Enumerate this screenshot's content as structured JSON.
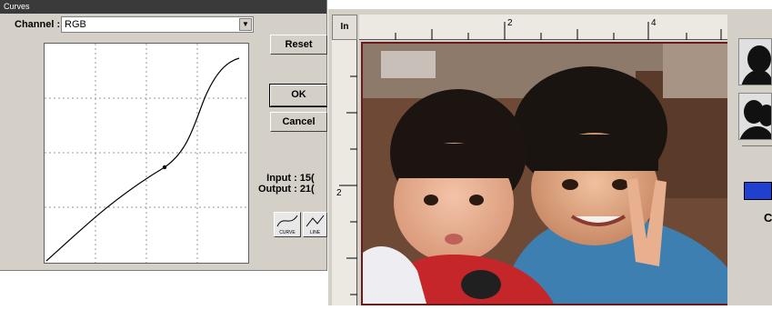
{
  "curves_dialog": {
    "title": "Curves",
    "channel_label": "Channel :",
    "channel_value": "RGB",
    "reset_label": "Reset",
    "ok_label": "OK",
    "cancel_label": "Cancel",
    "input_label": "Input : 15(",
    "output_label": "Output : 21(",
    "mode_buttons": [
      {
        "label": "CURVE",
        "icon": "curve-tool-icon"
      },
      {
        "label": "LINE",
        "icon": "line-tool-icon"
      }
    ]
  },
  "preview": {
    "unit_label": "In",
    "ruler_top_numbers": [
      "2",
      "4"
    ],
    "ruler_left_numbers": [
      "2"
    ]
  },
  "side_panel": {
    "letter": "C"
  }
}
